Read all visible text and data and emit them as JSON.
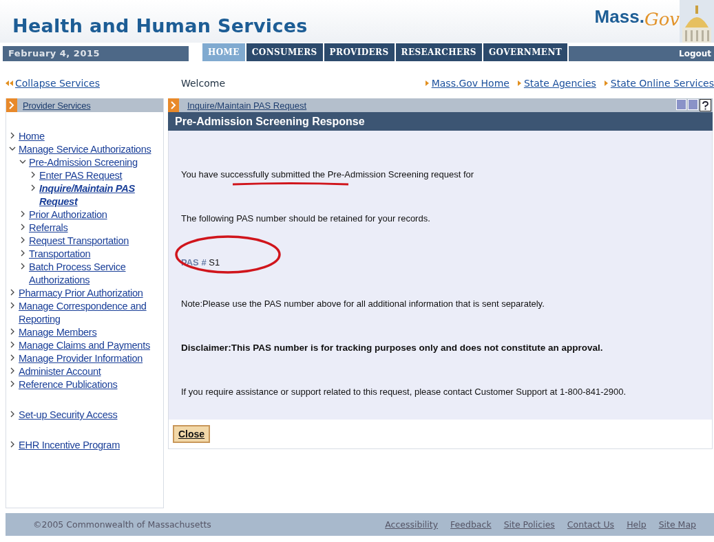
{
  "header": {
    "title": "Health and Human Services",
    "logo_text": "Mass.",
    "logo_script": "Gov"
  },
  "nav": {
    "date": "February 4, 2015",
    "tabs": [
      {
        "label": "HOME",
        "selected": true
      },
      {
        "label": "CONSUMERS",
        "selected": false
      },
      {
        "label": "PROVIDERS",
        "selected": false
      },
      {
        "label": "RESEARCHERS",
        "selected": false
      },
      {
        "label": "GOVERNMENT",
        "selected": false
      }
    ],
    "logout": "Logout"
  },
  "links_bar": {
    "collapse": "Collapse Services",
    "welcome": "Welcome",
    "links": [
      "Mass.Gov Home",
      "State Agencies",
      "State Online Services"
    ]
  },
  "sidebar": {
    "title": "Provider Services",
    "groups": [
      {
        "items": [
          {
            "label": "Home",
            "expanded": false,
            "selected": false
          },
          {
            "label": "Manage Service Authorizations",
            "expanded": true,
            "selected": false,
            "children": [
              {
                "label": "Pre-Admission Screening",
                "expanded": true,
                "selected": false,
                "children": [
                  {
                    "label": "Enter PAS Request",
                    "expanded": false,
                    "selected": false
                  },
                  {
                    "label": "Inquire/Maintain PAS Request",
                    "expanded": false,
                    "selected": true
                  }
                ]
              },
              {
                "label": "Prior Authorization",
                "expanded": false,
                "selected": false
              },
              {
                "label": "Referrals",
                "expanded": false,
                "selected": false
              },
              {
                "label": "Request Transportation",
                "expanded": false,
                "selected": false
              },
              {
                "label": "Transportation",
                "expanded": false,
                "selected": false
              },
              {
                "label": "Batch Process Service Authorizations",
                "expanded": false,
                "selected": false
              }
            ]
          },
          {
            "label": "Pharmacy Prior Authorization",
            "expanded": false,
            "selected": false
          },
          {
            "label": "Manage Correspondence and Reporting",
            "expanded": false,
            "selected": false
          },
          {
            "label": "Manage Members",
            "expanded": false,
            "selected": false
          },
          {
            "label": "Manage Claims and Payments",
            "expanded": false,
            "selected": false
          },
          {
            "label": "Manage Provider Information",
            "expanded": false,
            "selected": false
          },
          {
            "label": "Administer Account",
            "expanded": false,
            "selected": false
          },
          {
            "label": "Reference Publications",
            "expanded": false,
            "selected": false
          }
        ]
      },
      {
        "items": [
          {
            "label": "Set-up Security Access",
            "expanded": false,
            "selected": false
          }
        ]
      },
      {
        "items": [
          {
            "label": "EHR Incentive Program",
            "expanded": false,
            "selected": false
          }
        ]
      }
    ]
  },
  "panel": {
    "breadcrumb": "Inquire/Maintain PAS Request",
    "title": "Pre-Admission Screening Response",
    "paragraphs": [
      {
        "kind": "success",
        "text": "You have successfully submitted the Pre-Admission Screening request for"
      },
      {
        "kind": "plain",
        "text": "The following PAS number should be retained for your records."
      },
      {
        "kind": "pas",
        "label": "PAS #",
        "value": "S1"
      },
      {
        "kind": "plain",
        "text": "Note:Please use the PAS number above for all additional information that is sent separately."
      },
      {
        "kind": "bold",
        "text": "Disclaimer:This PAS number is for tracking purposes only and does not constitute an approval."
      },
      {
        "kind": "plain",
        "text": "If you require assistance or support related to this request, please contact Customer Support at 1-800-841-2900."
      }
    ],
    "button": "Close"
  },
  "footer": {
    "copyright": "©2005 Commonwealth of Massachusetts",
    "links": [
      "Accessibility",
      "Feedback",
      "Site Policies",
      "Contact Us",
      "Help",
      "Site Map"
    ]
  }
}
